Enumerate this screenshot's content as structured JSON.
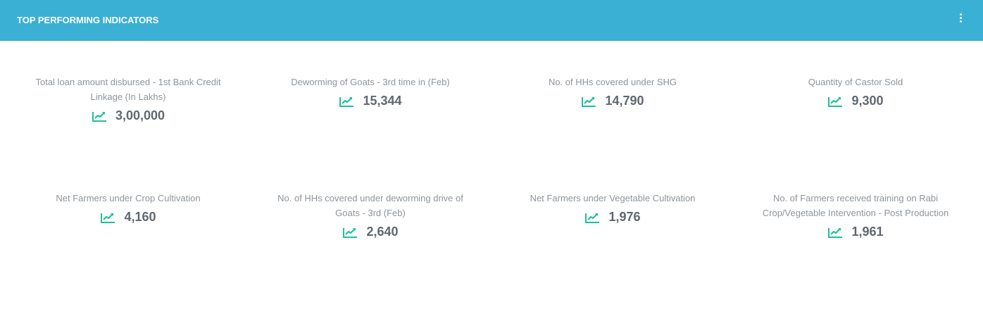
{
  "header": {
    "title": "TOP PERFORMING INDICATORS",
    "menu_icon": "vertical-dots-icon",
    "background_color": "#3ab0d4"
  },
  "colors": {
    "trend": "#1fbf9a",
    "label": "#8e959c",
    "value": "#5f6770"
  },
  "indicators": [
    {
      "label": "Total loan amount disbursed - 1st Bank Credit Linkage (In Lakhs)",
      "value": "3,00,000",
      "icon": "trend-up-icon"
    },
    {
      "label": "Deworming of Goats - 3rd time in (Feb)",
      "value": "15,344",
      "icon": "trend-up-icon"
    },
    {
      "label": "No. of HHs covered under SHG",
      "value": "14,790",
      "icon": "trend-up-icon"
    },
    {
      "label": "Quantity of Castor Sold",
      "value": "9,300",
      "icon": "trend-up-icon"
    },
    {
      "label": "Net Farmers under Crop Cultivation",
      "value": "4,160",
      "icon": "trend-up-icon"
    },
    {
      "label": "No. of HHs covered under deworming drive of Goats - 3rd (Feb)",
      "value": "2,640",
      "icon": "trend-up-icon"
    },
    {
      "label": "Net Farmers under Vegetable Cultivation",
      "value": "1,976",
      "icon": "trend-up-icon"
    },
    {
      "label": "No. of Farmers received training on Rabi Crop/Vegetable Intervention - Post Production",
      "value": "1,961",
      "icon": "trend-up-icon"
    }
  ]
}
